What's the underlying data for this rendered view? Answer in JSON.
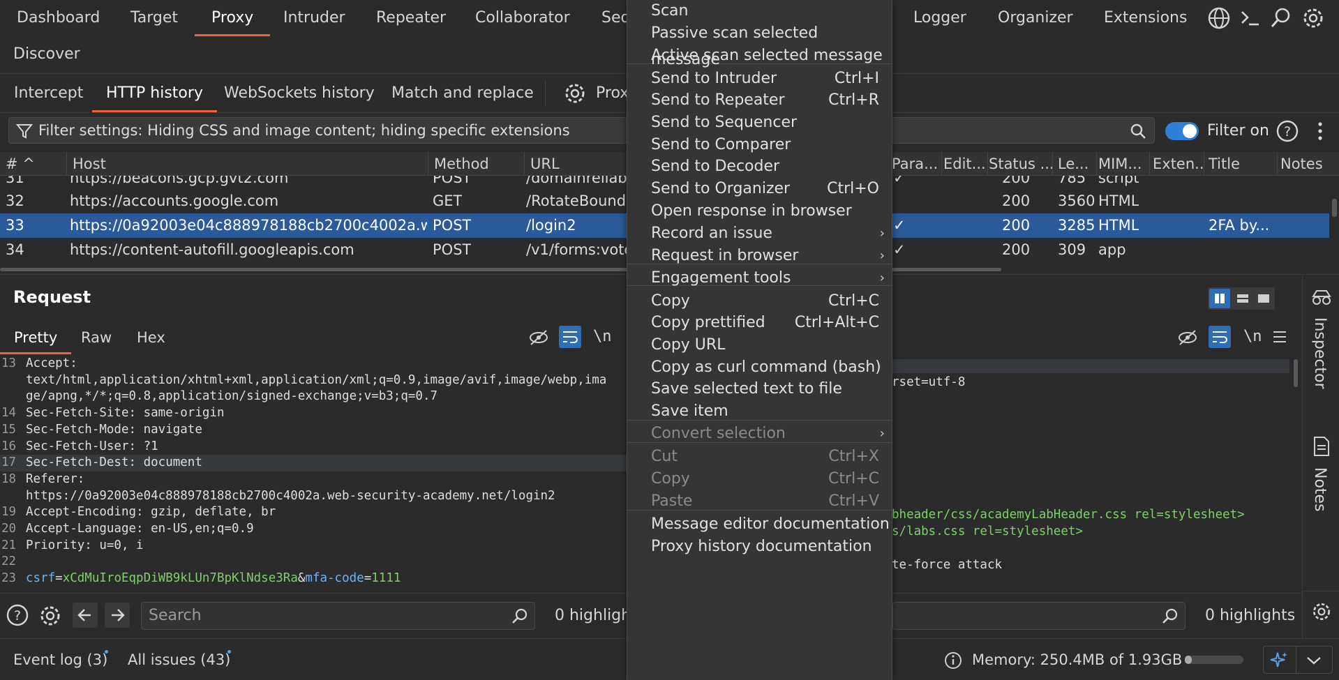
{
  "nav": {
    "tabs": [
      "Dashboard",
      "Target",
      "Proxy",
      "Intruder",
      "Repeater",
      "Collaborator",
      "Seq"
    ],
    "tabs_right": [
      "Logger",
      "Organizer",
      "Extensions"
    ],
    "second_row": "Discover"
  },
  "subnav": {
    "tabs": [
      "Intercept",
      "HTTP history",
      "WebSockets history",
      "Match and replace"
    ],
    "settings_label": "Prox"
  },
  "filter": {
    "text": "Filter settings: Hiding CSS and image content; hiding specific extensions",
    "toggle_label": "Filter on"
  },
  "table": {
    "headers_left": [
      "# ^",
      "Host",
      "Method",
      "URL"
    ],
    "headers_right": [
      "Para...",
      "Edit...",
      "Status ...",
      "Le...",
      "MIM...",
      "Exten...",
      "Title",
      "Notes"
    ],
    "partial_row": {
      "num": "31",
      "host": "https://beacons.gcp.gvt2.com",
      "method": "POST",
      "url": "/domainreliab",
      "check": "✓",
      "status": "200",
      "len": "785",
      "mime": "script"
    },
    "rows": [
      {
        "num": "32",
        "host": "https://accounts.google.com",
        "method": "GET",
        "url": "/RotateBound",
        "check": "",
        "status": "200",
        "len": "3560",
        "mime": "HTML",
        "title": ""
      },
      {
        "num": "33",
        "host": "https://0a92003e04c888978188cb2700c4002a.w...",
        "method": "POST",
        "url": "/login2",
        "check": "✓",
        "status": "200",
        "len": "3285",
        "mime": "HTML",
        "title": "2FA by..."
      },
      {
        "num": "34",
        "host": "https://content-autofill.googleapis.com",
        "method": "POST",
        "url": "/v1/forms:vote",
        "check": "✓",
        "status": "200",
        "len": "309",
        "mime": "app",
        "title": ""
      }
    ]
  },
  "request": {
    "title": "Request",
    "tabs": [
      "Pretty",
      "Raw",
      "Hex"
    ],
    "newline_label": "\\n",
    "lines": [
      {
        "n": "13",
        "key": "Accept:",
        "val": ""
      },
      {
        "n": "",
        "key": "",
        "val": "text/html,application/xhtml+xml,application/xml;q=0.9,image/avif,image/webp,ima"
      },
      {
        "n": "",
        "key": "",
        "val": "ge/apng,*/*;q=0.8,application/signed-exchange;v=b3;q=0.7"
      },
      {
        "n": "14",
        "key": "Sec-Fetch-Site:",
        "val": " same-origin"
      },
      {
        "n": "15",
        "key": "Sec-Fetch-Mode:",
        "val": " navigate"
      },
      {
        "n": "16",
        "key": "Sec-Fetch-User:",
        "val": " ?1"
      },
      {
        "n": "17",
        "key": "Sec-Fetch-Dest:",
        "val": " document"
      },
      {
        "n": "18",
        "key": "Referer:",
        "val": ""
      },
      {
        "n": "",
        "key": "",
        "val": "https://0a92003e04c888978188cb2700c4002a.web-security-academy.net/login2"
      },
      {
        "n": "19",
        "key": "Accept-Encoding:",
        "val": " gzip, deflate, br"
      },
      {
        "n": "20",
        "key": "Accept-Language:",
        "val": " en-US,en;q=0.9"
      },
      {
        "n": "21",
        "key": "Priority:",
        "val": " u=0, i"
      },
      {
        "n": "22",
        "key": "",
        "val": ""
      }
    ],
    "body_line": {
      "n": "23",
      "p1": "csrf",
      "eq1": "=",
      "v1": "xCdMuIroEqpDiWB9kLUn7BpKlNdse3Ra",
      "amp": "&",
      "p2": "mfa-code",
      "eq2": "=",
      "v2": "1111"
    }
  },
  "response": {
    "tabs_icons": [
      "eye-off",
      "wrap",
      "newline",
      "menu"
    ],
    "newline_label": "\\n",
    "lines": [
      "rset=utf-8",
      "bheader/css/academyLabHeader.css rel=stylesheet>",
      "s/labs.css rel=stylesheet>",
      "te-force attack"
    ],
    "rail_labels": [
      "Inspector",
      "Notes"
    ]
  },
  "search": {
    "placeholder": "Search",
    "highlights_left": "0 highligh",
    "highlights_right": "0 highlights"
  },
  "status": {
    "event_log": "Event log (3)",
    "issues": "All issues (43)",
    "memory": "Memory: 250.4MB of 1.93GB"
  },
  "context_menu": {
    "items": [
      {
        "label": "Scan",
        "shortcut": "",
        "sub": false,
        "disabled": false
      },
      {
        "label": "Passive scan selected message",
        "shortcut": "",
        "sub": false,
        "disabled": false
      },
      {
        "label": "Active scan selected message",
        "shortcut": "",
        "sub": false,
        "disabled": false
      },
      {
        "label": "Send to Intruder",
        "shortcut": "Ctrl+I",
        "sub": false,
        "disabled": false
      },
      {
        "label": "Send to Repeater",
        "shortcut": "Ctrl+R",
        "sub": false,
        "disabled": false
      },
      {
        "label": "Send to Sequencer",
        "shortcut": "",
        "sub": false,
        "disabled": false
      },
      {
        "label": "Send to Comparer",
        "shortcut": "",
        "sub": false,
        "disabled": false
      },
      {
        "label": "Send to Decoder",
        "shortcut": "",
        "sub": false,
        "disabled": false
      },
      {
        "label": "Send to Organizer",
        "shortcut": "Ctrl+O",
        "sub": false,
        "disabled": false
      },
      {
        "label": "Open response in browser",
        "shortcut": "",
        "sub": false,
        "disabled": false
      },
      {
        "label": "Record an issue",
        "shortcut": "",
        "sub": true,
        "disabled": false
      },
      {
        "label": "Request in browser",
        "shortcut": "",
        "sub": true,
        "disabled": false
      },
      {
        "label": "Engagement tools",
        "shortcut": "",
        "sub": true,
        "disabled": false
      },
      {
        "label": "Copy",
        "shortcut": "Ctrl+C",
        "sub": false,
        "disabled": false
      },
      {
        "label": "Copy prettified",
        "shortcut": "Ctrl+Alt+C",
        "sub": false,
        "disabled": false
      },
      {
        "label": "Copy URL",
        "shortcut": "",
        "sub": false,
        "disabled": false
      },
      {
        "label": "Copy as curl command (bash)",
        "shortcut": "",
        "sub": false,
        "disabled": false
      },
      {
        "label": "Save selected text to file",
        "shortcut": "",
        "sub": false,
        "disabled": false
      },
      {
        "label": "Save item",
        "shortcut": "",
        "sub": false,
        "disabled": false
      },
      {
        "label": "Convert selection",
        "shortcut": "",
        "sub": true,
        "disabled": true
      },
      {
        "label": "Cut",
        "shortcut": "Ctrl+X",
        "sub": false,
        "disabled": true
      },
      {
        "label": "Copy",
        "shortcut": "Ctrl+C",
        "sub": false,
        "disabled": true
      },
      {
        "label": "Paste",
        "shortcut": "Ctrl+V",
        "sub": false,
        "disabled": true
      },
      {
        "label": "Message editor documentation",
        "shortcut": "",
        "sub": false,
        "disabled": false
      },
      {
        "label": "Proxy history documentation",
        "shortcut": "",
        "sub": false,
        "disabled": false
      }
    ]
  },
  "colors": {
    "accent": "#e8673a",
    "selection": "#2a5a9a",
    "toggle": "#2f7fd8"
  }
}
